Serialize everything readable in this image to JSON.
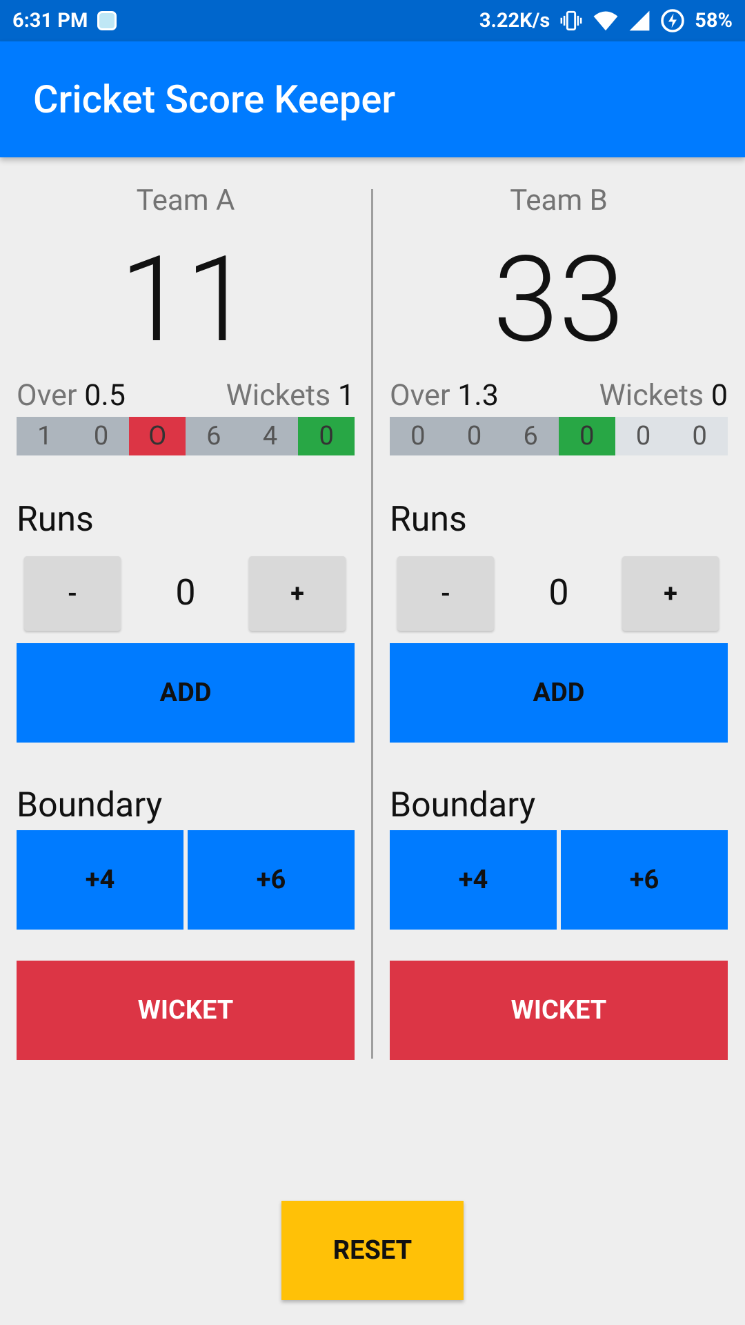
{
  "status_bar": {
    "time": "6:31 PM",
    "net_speed": "3.22K/s",
    "battery": "58%",
    "icons": [
      "app-notification-icon",
      "vibrate-icon",
      "wifi-icon",
      "signal-icon",
      "battery-charging-icon"
    ]
  },
  "app": {
    "title": "Cricket Score Keeper"
  },
  "colors": {
    "primary": "#007bff",
    "status_bar": "#0066cc",
    "danger": "#dc3545",
    "success": "#28a745",
    "warning": "#ffc107",
    "ball_gray": "#adb5bd",
    "ball_light": "#dee2e6"
  },
  "teams": [
    {
      "name": "Team A",
      "score": "11",
      "over_label": "Over",
      "over_value": "0.5",
      "wickets_label": "Wickets",
      "wickets_value": "1",
      "balls": [
        {
          "v": "1",
          "style": "gray"
        },
        {
          "v": "0",
          "style": "gray"
        },
        {
          "v": "O",
          "style": "red"
        },
        {
          "v": "6",
          "style": "gray"
        },
        {
          "v": "4",
          "style": "gray"
        },
        {
          "v": "0",
          "style": "green"
        }
      ],
      "runs_label": "Runs",
      "minus_label": "-",
      "run_value": "0",
      "plus_label": "+",
      "add_label": "ADD",
      "boundary_label": "Boundary",
      "four_label": "+4",
      "six_label": "+6",
      "wicket_label": "WICKET"
    },
    {
      "name": "Team B",
      "score": "33",
      "over_label": "Over",
      "over_value": "1.3",
      "wickets_label": "Wickets",
      "wickets_value": "0",
      "balls": [
        {
          "v": "0",
          "style": "gray"
        },
        {
          "v": "0",
          "style": "gray"
        },
        {
          "v": "6",
          "style": "gray"
        },
        {
          "v": "0",
          "style": "green"
        },
        {
          "v": "0",
          "style": "light"
        },
        {
          "v": "0",
          "style": "light"
        }
      ],
      "runs_label": "Runs",
      "minus_label": "-",
      "run_value": "0",
      "plus_label": "+",
      "add_label": "ADD",
      "boundary_label": "Boundary",
      "four_label": "+4",
      "six_label": "+6",
      "wicket_label": "WICKET"
    }
  ],
  "reset_label": "RESET"
}
